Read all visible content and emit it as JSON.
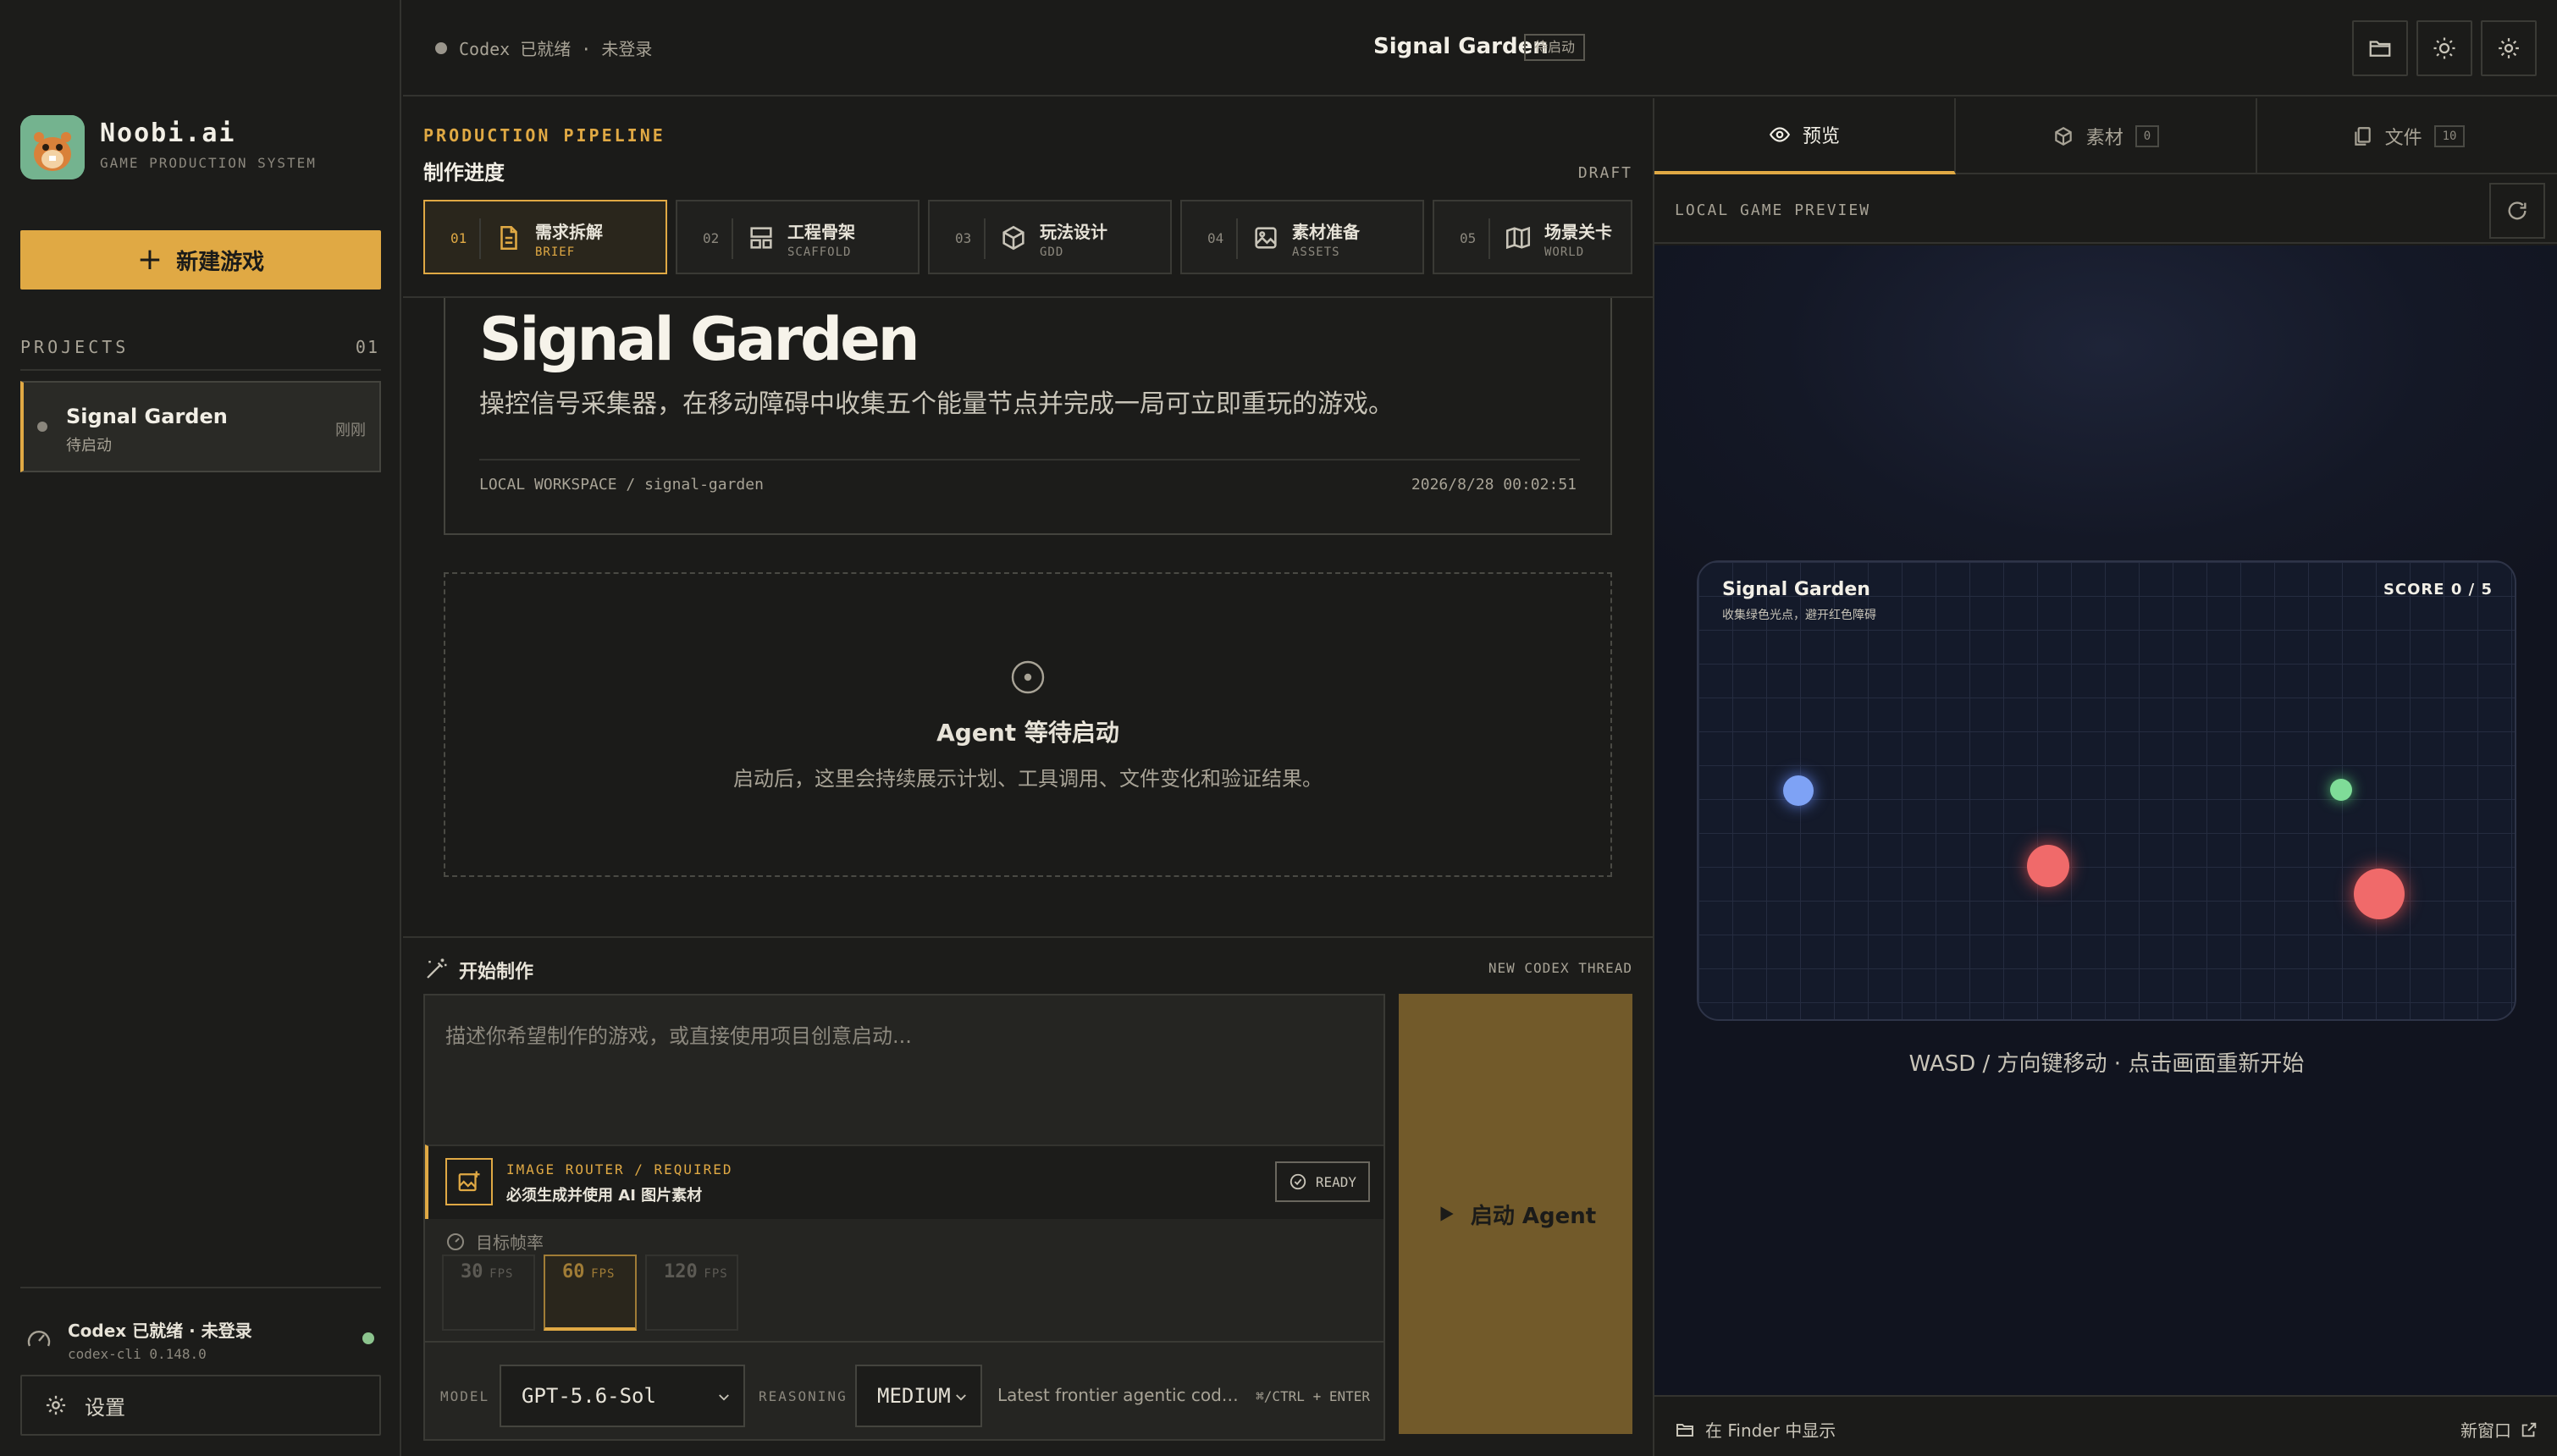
{
  "brand": {
    "name": "Noobi.ai",
    "subtitle": "GAME PRODUCTION SYSTEM"
  },
  "sidebar": {
    "new_game_label": "新建游戏",
    "projects_label": "PROJECTS",
    "projects_count": "01",
    "projects": [
      {
        "title": "Signal Garden",
        "status": "待启动",
        "time": "刚刚"
      }
    ],
    "codex_status": "Codex 已就绪 · 未登录",
    "codex_version": "codex-cli 0.148.0",
    "settings_label": "设置"
  },
  "header": {
    "status": "Codex 已就绪 · 未登录",
    "title": "Signal Garden",
    "badge": "待启动",
    "icons": [
      "folder-icon",
      "sun-icon",
      "gear-icon"
    ]
  },
  "pipeline": {
    "label": "PRODUCTION PIPELINE",
    "title": "制作进度",
    "state": "DRAFT",
    "steps": [
      {
        "num": "01",
        "title": "需求拆解",
        "code": "BRIEF",
        "icon": "document-icon",
        "active": true
      },
      {
        "num": "02",
        "title": "工程骨架",
        "code": "SCAFFOLD",
        "icon": "layout-icon",
        "active": false
      },
      {
        "num": "03",
        "title": "玩法设计",
        "code": "GDD",
        "icon": "cube-icon",
        "active": false
      },
      {
        "num": "04",
        "title": "素材准备",
        "code": "ASSETS",
        "icon": "image-icon",
        "active": false
      },
      {
        "num": "05",
        "title": "场景关卡",
        "code": "WORLD",
        "icon": "map-icon",
        "active": false
      }
    ]
  },
  "brief": {
    "title": "Signal Garden",
    "description": "操控信号采集器，在移动障碍中收集五个能量节点并完成一局可立即重玩的游戏。",
    "path": "LOCAL WORKSPACE / signal-garden",
    "date": "2026/8/28 00:02:51"
  },
  "agent": {
    "wait_title": "Agent 等待启动",
    "wait_desc": "启动后，这里会持续展示计划、工具调用、文件变化和验证结果。"
  },
  "composer": {
    "label": "开始制作",
    "thread": "NEW CODEX THREAD",
    "placeholder": "描述你希望制作的游戏，或直接使用项目创意启动...",
    "image_router_label": "IMAGE ROUTER / REQUIRED",
    "image_router_desc": "必须生成并使用 AI 图片素材",
    "ready": "READY",
    "fps_label": "目标帧率",
    "fps_options": [
      {
        "value": "30",
        "unit": "FPS"
      },
      {
        "value": "60",
        "unit": "FPS"
      },
      {
        "value": "120",
        "unit": "FPS"
      }
    ],
    "fps_selected": "60",
    "model_label": "MODEL",
    "model_value": "GPT-5.6-Sol",
    "reasoning_label": "REASONING",
    "reasoning_value": "MEDIUM",
    "model_desc": "Latest frontier agentic coding ...",
    "shortcut": "⌘/CTRL + ENTER",
    "launch_label": "启动 Agent"
  },
  "right_panel": {
    "tabs": [
      {
        "label": "预览",
        "icon": "eye-icon",
        "count": "",
        "active": true
      },
      {
        "label": "素材",
        "icon": "box-icon",
        "count": "0",
        "active": false
      },
      {
        "label": "文件",
        "icon": "files-icon",
        "count": "10",
        "active": false
      }
    ],
    "preview_label": "LOCAL GAME PREVIEW",
    "game": {
      "title": "Signal Garden",
      "subtitle": "收集绿色光点，避开红色障碍",
      "score": "SCORE 0 / 5"
    },
    "hint": "WASD / 方向键移动 · 点击画面重新开始",
    "finder_label": "在 Finder 中显示",
    "new_window_label": "新窗口"
  },
  "colors": {
    "accent": "#e0a944",
    "background": "#1b1b19",
    "player": "#7ea2f5",
    "energy_node": "#7fdc98",
    "obstacle": "#f06a6a"
  }
}
